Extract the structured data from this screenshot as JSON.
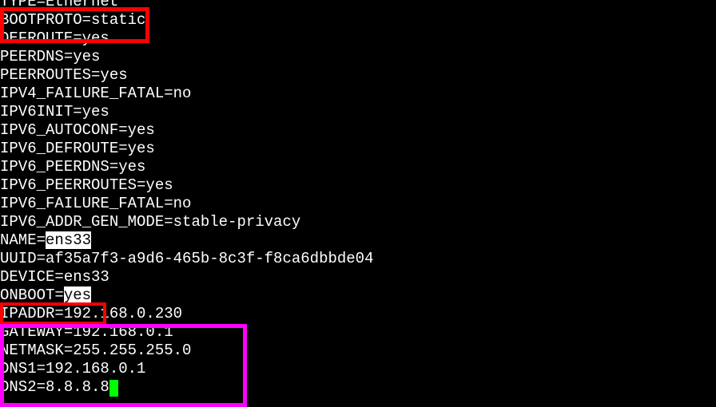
{
  "cfg": {
    "type_line": "TYPE=Ethernet",
    "bootproto_line": "BOOTPROTO=static",
    "defroute_line": "DEFROUTE=yes",
    "peerdns_line": "PEERDNS=yes",
    "peerroutes_line": "PEERROUTES=yes",
    "ipv4_failure_line": "IPV4_FAILURE_FATAL=no",
    "ipv6init_line": "IPV6INIT=yes",
    "ipv6_autoconf_line": "IPV6_AUTOCONF=yes",
    "ipv6_defroute_line": "IPV6_DEFROUTE=yes",
    "ipv6_peerdns_line": "IPV6_PEERDNS=yes",
    "ipv6_peerroutes_line": "IPV6_PEERROUTES=yes",
    "ipv6_failure_line": "IPV6_FAILURE_FATAL=no",
    "ipv6_addr_gen_line": "IPV6_ADDR_GEN_MODE=stable-privacy",
    "name_key": "NAME=",
    "name_val": "ens33",
    "uuid_line": "UUID=af35a7f3-a9d6-465b-8c3f-f8ca6dbbde04",
    "device_line": "DEVICE=ens33",
    "onboot_key": "ONBOOT=",
    "onboot_val": "yes",
    "ipaddr_line": "IPADDR=192.168.0.230",
    "gateway_line": "GATEWAY=192.168.0.1",
    "netmask_line": "NETMASK=255.255.255.0",
    "dns1_line": "DNS1=192.168.0.1",
    "dns2_line": "DNS2=8.8.8.8"
  }
}
